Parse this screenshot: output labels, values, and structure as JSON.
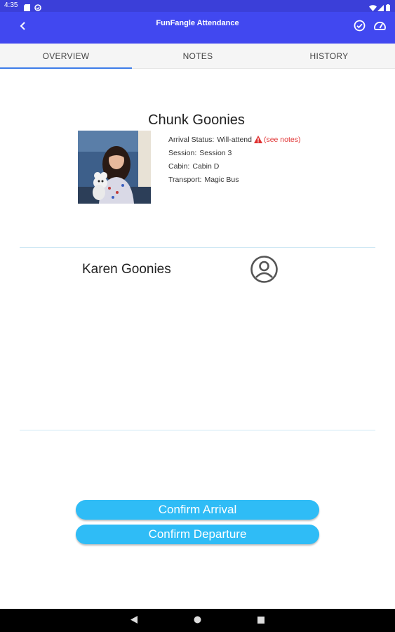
{
  "status_bar": {
    "time": "4:35",
    "icons": [
      "sd-card-icon",
      "sync-icon",
      "wifi-icon",
      "signal-icon",
      "battery-icon"
    ]
  },
  "app_bar": {
    "title": "FunFangle Attendance",
    "background": "#4148f0",
    "actions": [
      "check-circle-icon",
      "speedometer-icon"
    ]
  },
  "tabs": [
    {
      "label": "OVERVIEW",
      "active": true
    },
    {
      "label": "NOTES",
      "active": false
    },
    {
      "label": "HISTORY",
      "active": false
    }
  ],
  "camper": {
    "name": "Chunk Goonies",
    "arrival_status_label": "Arrival Status:",
    "arrival_status_value": "Will-attend",
    "see_notes": "(see notes)",
    "session_label": "Session:",
    "session_value": "Session 3",
    "cabin_label": "Cabin:",
    "cabin_value": "Cabin D",
    "transport_label": "Transport:",
    "transport_value": "Magic Bus"
  },
  "guardian": {
    "name": "Karen Goonies"
  },
  "buttons": {
    "confirm_arrival": "Confirm Arrival",
    "confirm_departure": "Confirm Departure"
  },
  "colors": {
    "accent": "#2fbcf6",
    "warning": "#e03131",
    "tab_indicator": "#3d7ce8"
  }
}
